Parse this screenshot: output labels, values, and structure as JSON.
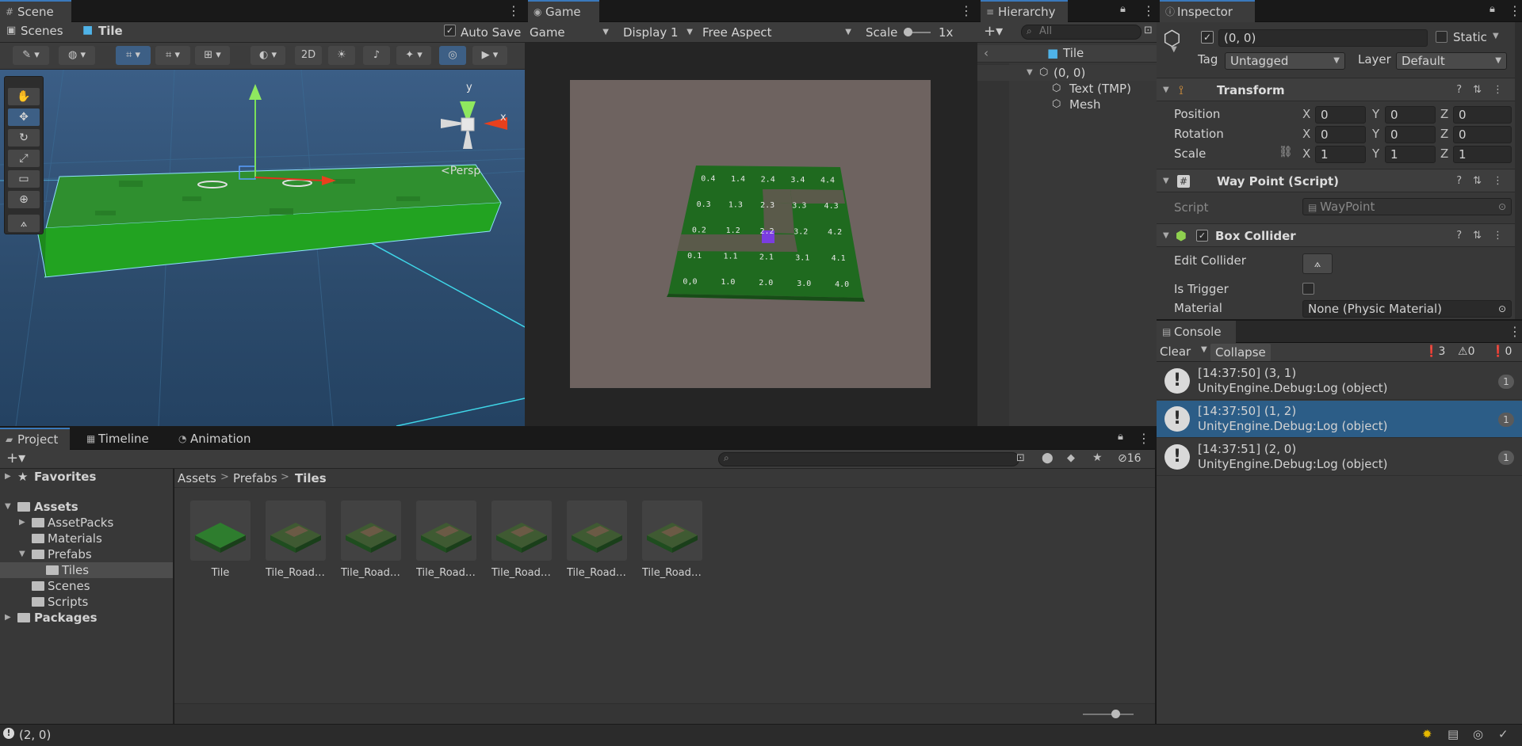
{
  "scene": {
    "tab": "Scene",
    "breadcrumb": [
      "Scenes",
      "Tile"
    ],
    "auto_save": "Auto Save",
    "mode_2d": "2D",
    "persp": "Persp",
    "gizmo_y": "y",
    "gizmo_x": "x"
  },
  "game": {
    "tab": "Game",
    "view_dropdown": "Game",
    "display_dropdown": "Display 1",
    "aspect_dropdown": "Free Aspect",
    "scale_label": "Scale",
    "scale_value": "1x",
    "tile_labels": [
      "0.4",
      "1.4",
      "2.4",
      "3.4",
      "4.4",
      "0.3",
      "1.3",
      "2.3",
      "3.3",
      "4.3",
      "0.2",
      "1.2",
      "2.2",
      "3.2",
      "4.2",
      "0.1",
      "1.1",
      "2.1",
      "3.1",
      "4.1",
      "0,0",
      "1.0",
      "2.0",
      "3.0",
      "4.0"
    ]
  },
  "hierarchy": {
    "tab": "Hierarchy",
    "search_placeholder": "All",
    "root": "Tile",
    "items": [
      "(0, 0)",
      "Text (TMP)",
      "Mesh"
    ]
  },
  "inspector": {
    "tab": "Inspector",
    "object_name": "(0, 0)",
    "static_label": "Static",
    "tag_label": "Tag",
    "tag_value": "Untagged",
    "layer_label": "Layer",
    "layer_value": "Default",
    "transform": {
      "title": "Transform",
      "position_label": "Position",
      "rotation_label": "Rotation",
      "scale_label": "Scale",
      "position": [
        "0",
        "0",
        "0"
      ],
      "rotation": [
        "0",
        "0",
        "0"
      ],
      "scale": [
        "1",
        "1",
        "1"
      ]
    },
    "waypoint": {
      "title": "Way Point (Script)",
      "script_label": "Script",
      "script_value": "WayPoint"
    },
    "box_collider": {
      "title": "Box Collider",
      "edit_collider": "Edit Collider",
      "is_trigger": "Is Trigger",
      "material_label": "Material",
      "material_value": "None (Physic Material)"
    }
  },
  "console": {
    "tab": "Console",
    "clear": "Clear",
    "collapse": "Collapse",
    "count_log": "3",
    "count_warn": "0",
    "count_err": "0",
    "entries": [
      {
        "line1": "[14:37:50] (3, 1)",
        "line2": "UnityEngine.Debug:Log (object)",
        "count": "1"
      },
      {
        "line1": "[14:37:50] (1, 2)",
        "line2": "UnityEngine.Debug:Log (object)",
        "count": "1"
      },
      {
        "line1": "[14:37:51] (2, 0)",
        "line2": "UnityEngine.Debug:Log (object)",
        "count": "1"
      }
    ]
  },
  "project": {
    "tabs": [
      "Project",
      "Timeline",
      "Animation"
    ],
    "hidden_count": "16",
    "breadcrumb": [
      "Assets",
      "Prefabs",
      "Tiles"
    ],
    "tree": {
      "favorites": "Favorites",
      "assets": "Assets",
      "asset_packs": "AssetPacks",
      "materials": "Materials",
      "prefabs": "Prefabs",
      "tiles": "Tiles",
      "scenes": "Scenes",
      "scripts": "Scripts",
      "packages": "Packages"
    },
    "assets": [
      "Tile",
      "Tile_RoadC...",
      "Tile_RoadC...",
      "Tile_RoadC...",
      "Tile_RoadC...",
      "Tile_RoadS...",
      "Tile_RoadS..."
    ]
  },
  "status": {
    "message": "(2, 0)"
  },
  "colors": {
    "accent": "#3a79bb",
    "selection": "#2c5d87",
    "grass": "#2f8f2f"
  }
}
